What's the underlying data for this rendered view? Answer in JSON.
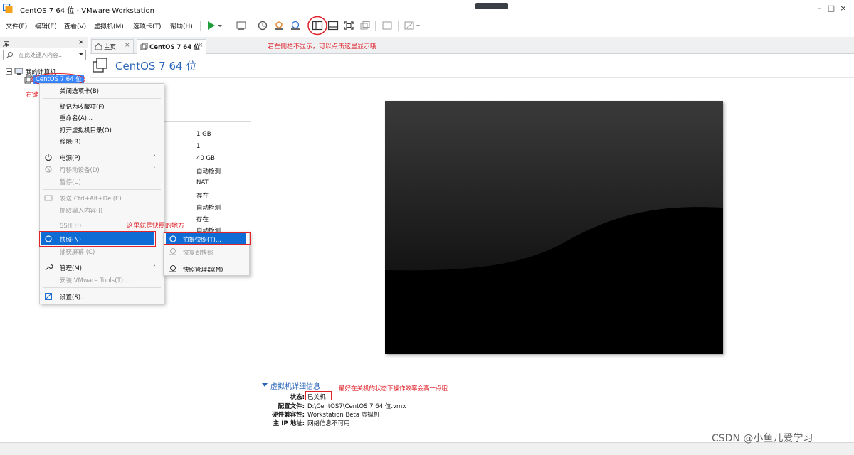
{
  "window": {
    "title": "CentOS 7 64 位 - VMware Workstation",
    "controls": [
      "–",
      "□",
      "×"
    ]
  },
  "menu": [
    "文件(F)",
    "编辑(E)",
    "查看(V)",
    "虚拟机(M)",
    "选项卡(T)",
    "帮助(H)"
  ],
  "toolbar": {
    "icons": [
      "play-icon",
      "dropdown-icon",
      "send-ctrl-alt-del-icon",
      "snapshot-icon",
      "revert-snapshot-icon",
      "snapshot-manager-icon",
      "show-library-icon",
      "thumbnail-bar-icon",
      "fullscreen-icon",
      "unity-icon",
      "console-view-icon",
      "stretch-icon"
    ],
    "highlight_color": "#e0222a"
  },
  "sidebar": {
    "title": "库",
    "close": "×",
    "search_placeholder": "在此处键入内容...",
    "tree_root": "我的计算机",
    "tree_vm": "CentOS 7 64 位",
    "annotation": "右键点击"
  },
  "tabs": {
    "home": "主页",
    "vm": "CentOS 7 64 位",
    "close": "×",
    "annotation": "若左侧栏不显示，可以点击这里显示哦"
  },
  "vm_heading": "CentOS 7 64 位",
  "devices_values": [
    "1 GB",
    "1",
    "40 GB",
    "自动检测",
    "NAT",
    "存在",
    "自动检测",
    "存在",
    "自动检测"
  ],
  "context_menu": {
    "items": [
      {
        "label": "关闭选项卡(B)",
        "disabled": false
      },
      {
        "label": "标记为收藏项(F)",
        "disabled": false
      },
      {
        "label": "重命名(A)...",
        "disabled": false
      },
      {
        "label": "打开虚拟机目录(O)",
        "disabled": false
      },
      {
        "label": "移除(R)",
        "disabled": false
      },
      {
        "label": "电源(P)",
        "disabled": false,
        "submenu": true
      },
      {
        "label": "可移动设备(D)",
        "disabled": true,
        "submenu": true
      },
      {
        "label": "暂停(U)",
        "disabled": true
      },
      {
        "label": "发送 Ctrl+Alt+Del(E)",
        "disabled": true
      },
      {
        "label": "抓取输入内容(I)",
        "disabled": true
      },
      {
        "label": "SSH(H)",
        "disabled": true
      },
      {
        "label": "快照(N)",
        "disabled": false,
        "submenu": true,
        "highlighted": true
      },
      {
        "label": "捕获屏幕 (C)",
        "disabled": true
      },
      {
        "label": "管理(M)",
        "disabled": false,
        "submenu": true
      },
      {
        "label": "安装 VMware Tools(T)...",
        "disabled": true
      },
      {
        "label": "设置(S)...",
        "disabled": false
      }
    ],
    "annotation": "这里就是快照的地方"
  },
  "snapshot_submenu": [
    {
      "label": "拍摄快照(T)...",
      "disabled": false,
      "highlighted": true
    },
    {
      "label": "恢复到快照",
      "disabled": true
    },
    {
      "label": "快照管理器(M)",
      "disabled": false
    }
  ],
  "details": {
    "title": "虚拟机详细信息",
    "annotation": "最好在关机的状态下操作效率会高一点哦",
    "rows": [
      {
        "label": "状态:",
        "value": "已关机"
      },
      {
        "label": "配置文件:",
        "value": "D:\\CentOS7\\CentOS 7 64 位.vmx"
      },
      {
        "label": "硬件兼容性:",
        "value": "Workstation Beta 虚拟机"
      },
      {
        "label": "主 IP 地址:",
        "value": "网络信息不可用"
      }
    ]
  },
  "watermark": "CSDN @小鱼儿爱学习"
}
